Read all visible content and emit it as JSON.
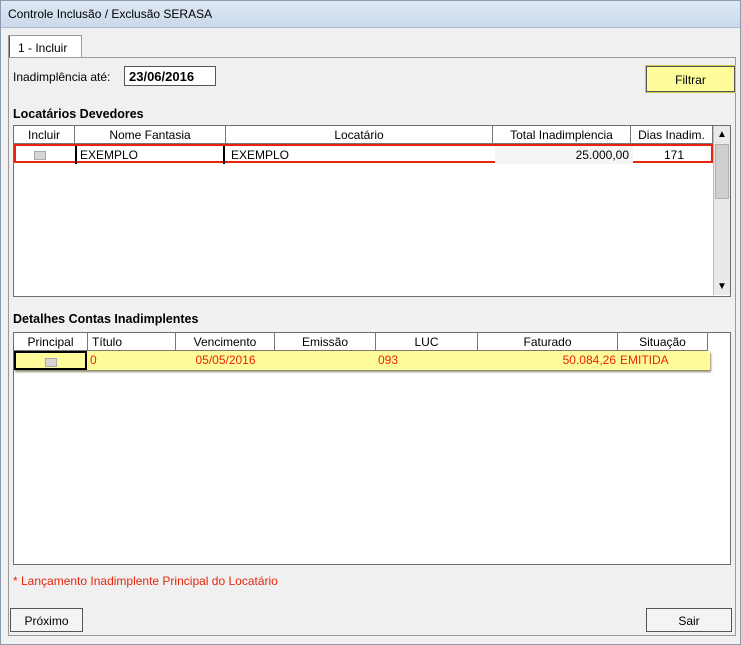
{
  "window": {
    "title": "Controle Inclusão / Exclusão SERASA"
  },
  "tabs": [
    {
      "label": "1 - Incluir"
    }
  ],
  "filter": {
    "label": "Inadimplência até:",
    "date_value": "23/06/2016",
    "button": "Filtrar"
  },
  "devedores": {
    "title": "Locatários Devedores",
    "columns": [
      "Incluir",
      "Nome Fantasia",
      "Locatário",
      "Total Inadimplencia",
      "Dias Inadim."
    ],
    "rows": [
      {
        "incluir": "",
        "nome_fantasia": "EXEMPLO",
        "locatario": "EXEMPLO",
        "total": "25.000,00",
        "dias": "171"
      }
    ]
  },
  "detalhes": {
    "title": "Detalhes Contas Inadimplentes",
    "columns": [
      "Principal",
      "Título",
      "Vencimento",
      "Emissão",
      "LUC",
      "Faturado",
      "Situação"
    ],
    "rows": [
      {
        "principal": "",
        "titulo": "0",
        "vencimento": "05/05/2016",
        "emissao": "",
        "luc": "093",
        "faturado": "50.084,26",
        "situacao": "EMITIDA"
      }
    ]
  },
  "note": "* Lançamento Inadimplente Principal do Locatário",
  "footer": {
    "next_button": "Próximo",
    "exit_button": "Sair"
  },
  "colors": {
    "highlight_yellow": "#fefb9a",
    "selection_red": "#e8240c",
    "note_red": "#e8240c"
  },
  "icons": {
    "scroll_up": "scroll-up-icon",
    "scroll_down": "scroll-down-icon"
  }
}
